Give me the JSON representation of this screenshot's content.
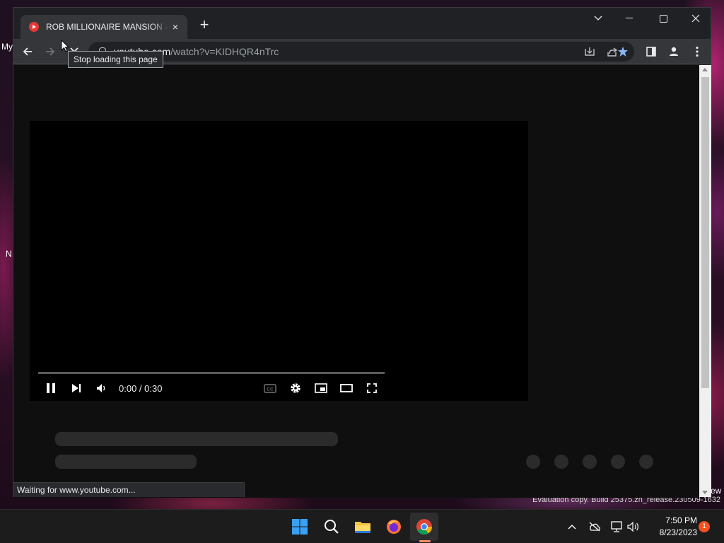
{
  "desktop": {
    "label_a": "My",
    "label_b": "N",
    "label_c": "ew",
    "watermark": "Evaluation copy. Build 25375.zn_release.230509-1632"
  },
  "browser": {
    "tab_title": "ROB MILLIONAIRE MANSION - R",
    "tab_close": "×",
    "new_tab": "+",
    "url_host": "youtube.com",
    "url_path": "/watch?v=KIDHQR4nTrc",
    "tooltip": "Stop loading this page",
    "status": "Waiting for www.youtube.com...",
    "accent": "#8ab4f8"
  },
  "player": {
    "time": "0:00 / 0:30",
    "progress": 0.0
  },
  "taskbar": {
    "time": "7:50 PM",
    "date": "8/23/2023",
    "notifications": "1"
  }
}
